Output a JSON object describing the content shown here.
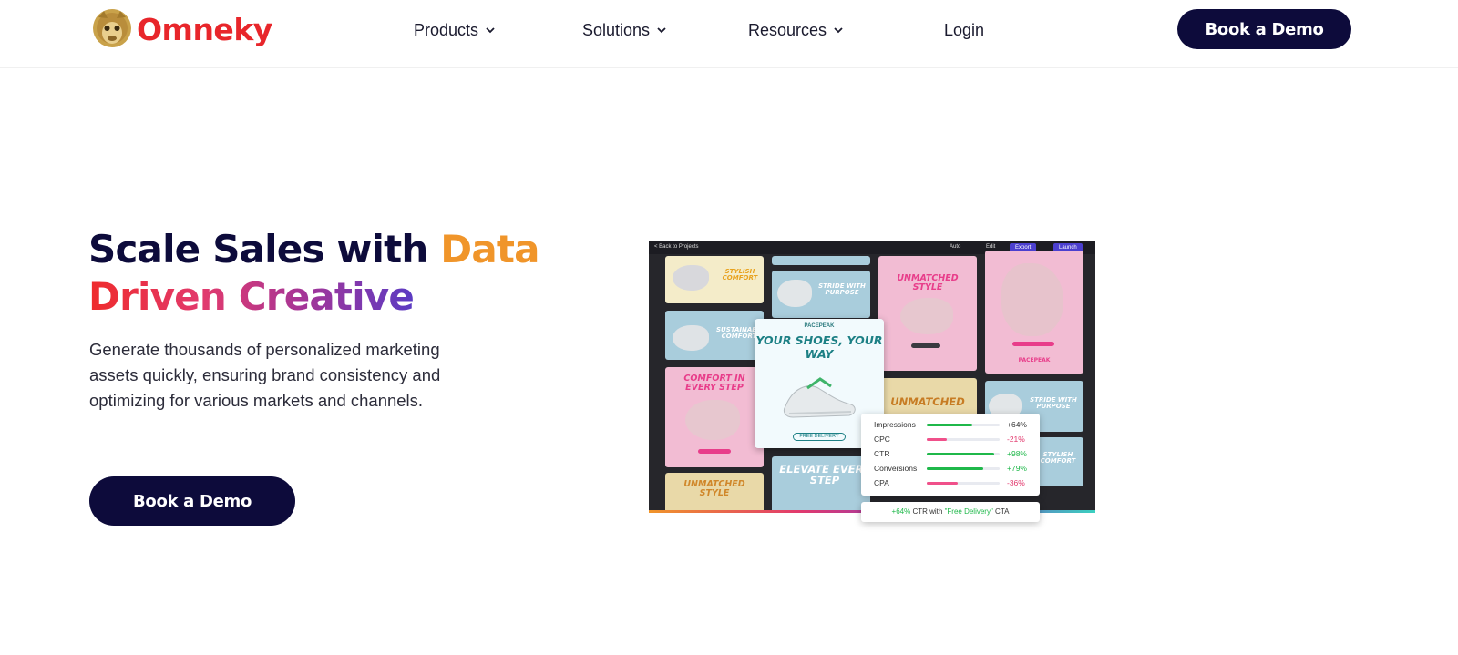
{
  "brand": {
    "name": "Omneky",
    "color": "#e8262b"
  },
  "nav": {
    "items": [
      {
        "label": "Products",
        "has_dropdown": true
      },
      {
        "label": "Solutions",
        "has_dropdown": true
      },
      {
        "label": "Resources",
        "has_dropdown": true
      },
      {
        "label": "Login",
        "has_dropdown": false
      }
    ],
    "cta_label": "Book a Demo"
  },
  "hero": {
    "title_part1": "Scale Sales with ",
    "title_part2": "Data",
    "title_part3": "Driven Creative",
    "description": "Generate thousands of personalized marketing assets quickly, ensuring brand consistency and optimizing for various markets and channels.",
    "cta_label": "Book a Demo"
  },
  "mockup": {
    "toolbar": {
      "back_label": "< Back to Projects",
      "auto_label": "Auto",
      "edit_label": "Edit",
      "export_label": "Export",
      "launch_label": "Launch"
    },
    "tiles": {
      "stylish_comfort": "STYLISH COMFORT",
      "stride_purpose": "STRIDE WITH PURPOSE",
      "unmatched_style": "UNMATCHED STYLE",
      "sustainable_comfort": "SUSTAINABLE COMFORT",
      "comfort_every_step": "COMFORT IN EVERY STEP",
      "unmatched_style_2": "UNMATCHED STYLE",
      "elevate_every_step": "ELEVATE EVERY STEP",
      "unmatched": "UNMATCHED",
      "stride_purpose_2": "STRIDE WITH PURPOSE",
      "stylish_comfort_2": "STYLISH COMFORT",
      "brand_small": "PACEPEAK"
    },
    "ad_card": {
      "brand": "PACEPEAK",
      "title": "YOUR SHOES, YOUR WAY",
      "cta": "FREE DELIVERY"
    },
    "metrics": [
      {
        "label": "Impressions",
        "value": "+64%",
        "level": 0.62,
        "color": "#1fb84a",
        "value_color": "#333333"
      },
      {
        "label": "CPC",
        "value": "-21%",
        "level": 0.28,
        "color": "#f0508a",
        "value_color": "#e2386d"
      },
      {
        "label": "CTR",
        "value": "+98%",
        "level": 0.92,
        "color": "#1fb84a",
        "value_color": "#1fb84a"
      },
      {
        "label": "Conversions",
        "value": "+79%",
        "level": 0.78,
        "color": "#1fb84a",
        "value_color": "#1fb84a"
      },
      {
        "label": "CPA",
        "value": "-36%",
        "level": 0.42,
        "color": "#f0508a",
        "value_color": "#e2386d"
      }
    ],
    "ctr_note": {
      "highlight": "+64%",
      "middle": " CTR with ",
      "quote": "\"Free Delivery\"",
      "end": " CTA"
    }
  },
  "colors": {
    "navy": "#0d0b3b",
    "orange": "#f0952a",
    "green": "#1fb84a",
    "pink": "#f0508a"
  }
}
